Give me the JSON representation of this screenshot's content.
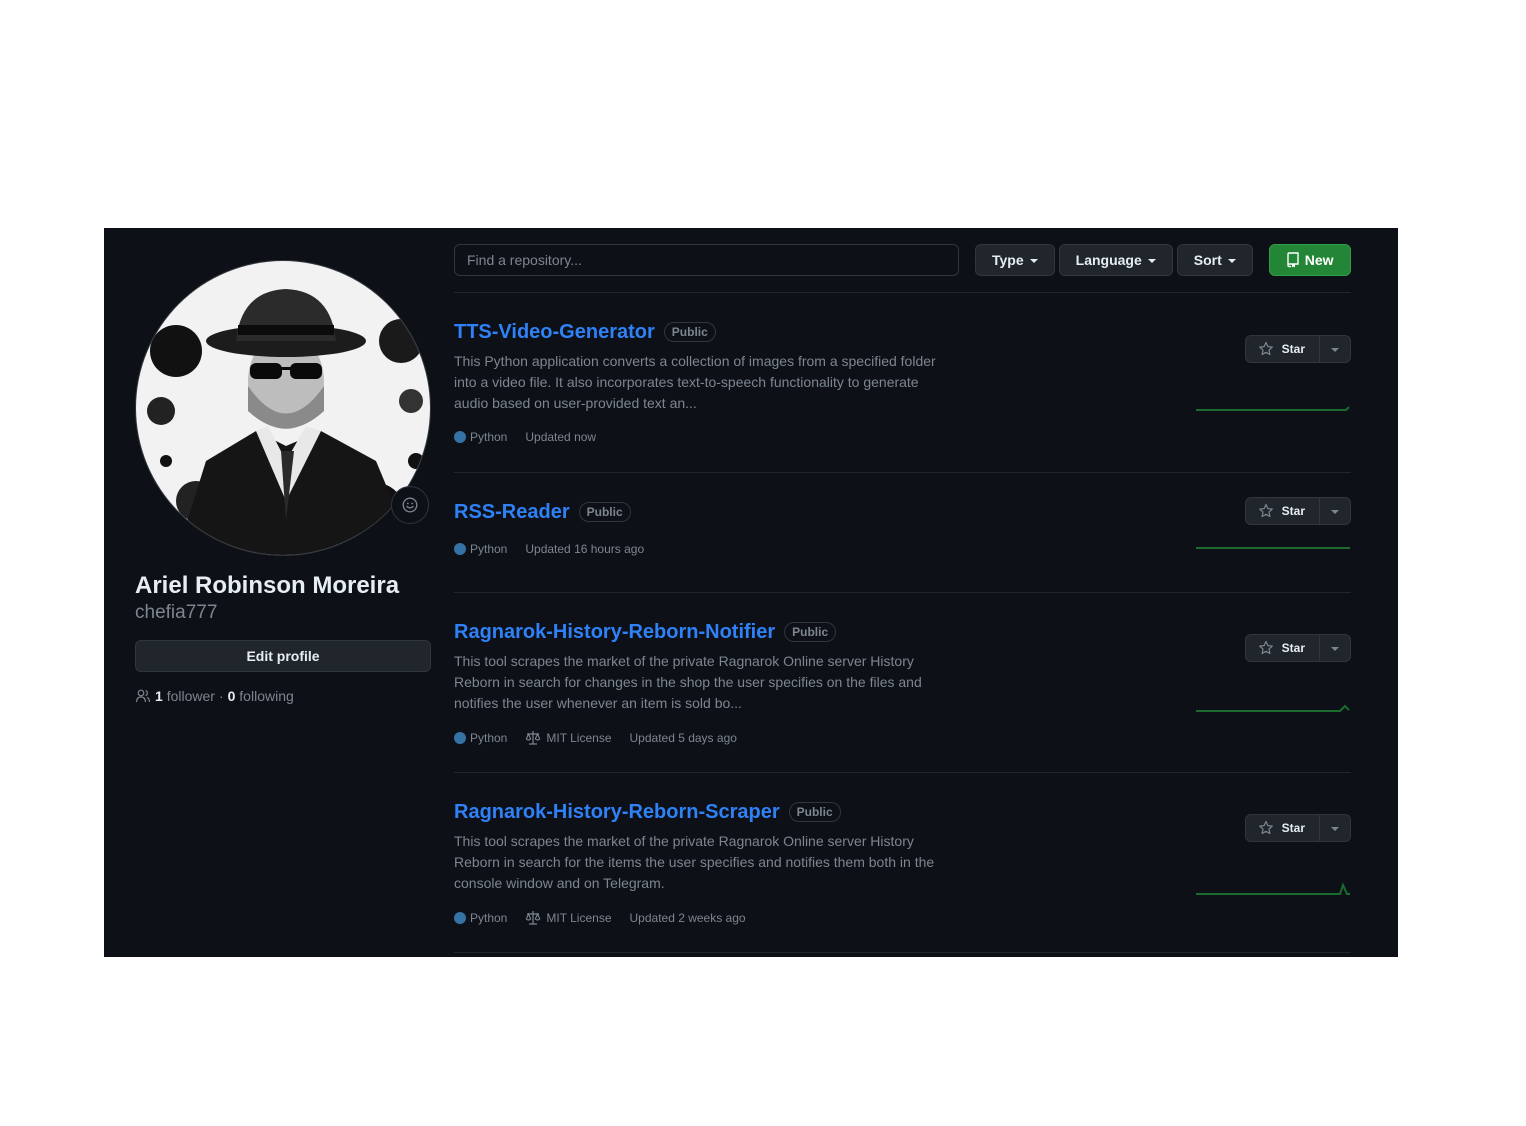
{
  "profile": {
    "fullname": "Ariel Robinson Moreira",
    "login": "chefia777",
    "edit_label": "Edit profile",
    "followers_count": "1",
    "followers_label": "follower",
    "separator": "·",
    "following_count": "0",
    "following_label": "following"
  },
  "filters": {
    "search_placeholder": "Find a repository...",
    "type_label": "Type",
    "language_label": "Language",
    "sort_label": "Sort",
    "new_label": "New"
  },
  "colors": {
    "background": "#0d1117",
    "accent_link": "#2f81f7",
    "new_button": "#238636",
    "python": "#3572A5",
    "sparkline": "#196c2e"
  },
  "repos": [
    {
      "name": "TTS-Video-Generator",
      "visibility": "Public",
      "description": "This Python application converts a collection of images from a specified folder into a video file. It also incorporates text-to-speech functionality to generate audio based on user-provided text an...",
      "language": "Python",
      "license": "",
      "updated": "Updated now",
      "star_label": "Star"
    },
    {
      "name": "RSS-Reader",
      "visibility": "Public",
      "description": "",
      "language": "Python",
      "license": "",
      "updated": "Updated 16 hours ago",
      "star_label": "Star"
    },
    {
      "name": "Ragnarok-History-Reborn-Notifier",
      "visibility": "Public",
      "description": "This tool scrapes the market of the private Ragnarok Online server History Reborn in search for changes in the shop the user specifies on the files and notifies the user whenever an item is sold bo...",
      "language": "Python",
      "license": "MIT License",
      "updated": "Updated 5 days ago",
      "star_label": "Star"
    },
    {
      "name": "Ragnarok-History-Reborn-Scraper",
      "visibility": "Public",
      "description": "This tool scrapes the market of the private Ragnarok Online server History Reborn in search for the items the user specifies and notifies them both in the console window and on Telegram.",
      "language": "Python",
      "license": "MIT License",
      "updated": "Updated 2 weeks ago",
      "star_label": "Star"
    }
  ]
}
